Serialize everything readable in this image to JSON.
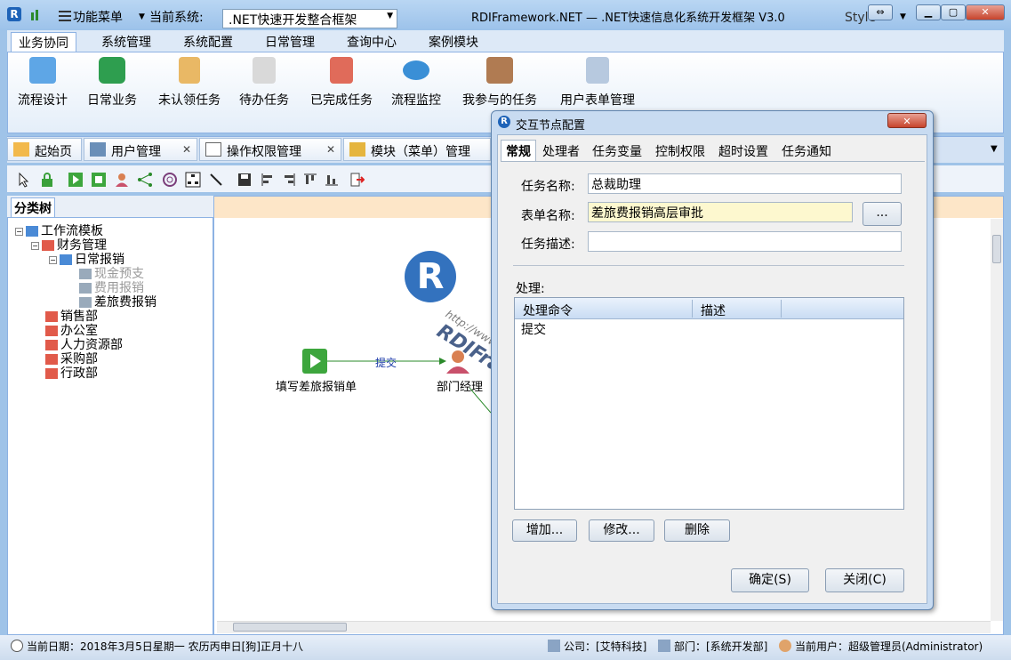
{
  "titlebar": {
    "menu_label": "功能菜单",
    "current_system_label": "当前系统:",
    "current_system_value": ".NET快速开发整合框架",
    "app_title": "RDIFramework.NET — .NET快速信息化系统开发框架 V3.0",
    "style_label": "Style"
  },
  "ribbon": {
    "tabs": [
      "业务协同",
      "系统管理",
      "系统配置",
      "日常管理",
      "查询中心",
      "案例模块"
    ],
    "buttons": [
      "流程设计",
      "日常业务",
      "未认领任务",
      "待办任务",
      "已完成任务",
      "流程监控",
      "我参与的任务",
      "用户表单管理"
    ]
  },
  "doctabs": [
    "起始页",
    "用户管理",
    "操作权限管理",
    "模块（菜单）管理"
  ],
  "tree": {
    "header": "分类树",
    "nodes": [
      "工作流模板",
      "财务管理",
      "日常报销",
      "现金预支",
      "费用报销",
      "差旅费报销",
      "销售部",
      "办公室",
      "人力资源部",
      "采购部",
      "行政部"
    ]
  },
  "designer": {
    "start_node": "填写差旅报销单",
    "edge_label": "提交",
    "next_node": "部门经理",
    "watermark_brand": "RDIFramework.NET",
    "watermark_url": "http://www.rdiframework.net/"
  },
  "dialog": {
    "title": "交互节点配置",
    "tabs": [
      "常规",
      "处理者",
      "任务变量",
      "控制权限",
      "超时设置",
      "任务通知"
    ],
    "task_name_label": "任务名称:",
    "task_name_value": "总裁助理",
    "form_name_label": "表单名称:",
    "form_name_value": "差旅费报销高层审批",
    "browse_label": "...",
    "task_desc_label": "任务描述:",
    "task_desc_value": "",
    "process_label": "处理:",
    "table_headers": [
      "处理命令",
      "描述"
    ],
    "table_rows": [
      [
        "提交",
        ""
      ]
    ],
    "add_label": "增加...",
    "edit_label": "修改...",
    "delete_label": "删除",
    "ok_label": "确定(S)",
    "close_label": "关闭(C)"
  },
  "status": {
    "date": "当前日期：2018年3月5日星期一 农历丙申日[狗]正月十八",
    "company": "公司：[艾特科技]",
    "department": "部门：[系统开发部]",
    "user": "当前用户：超级管理员(Administrator)"
  },
  "colors": {
    "accent": "#1e63b8",
    "dialog_frame": "#c8dbf1",
    "designer_bar": "#fde6c8"
  }
}
